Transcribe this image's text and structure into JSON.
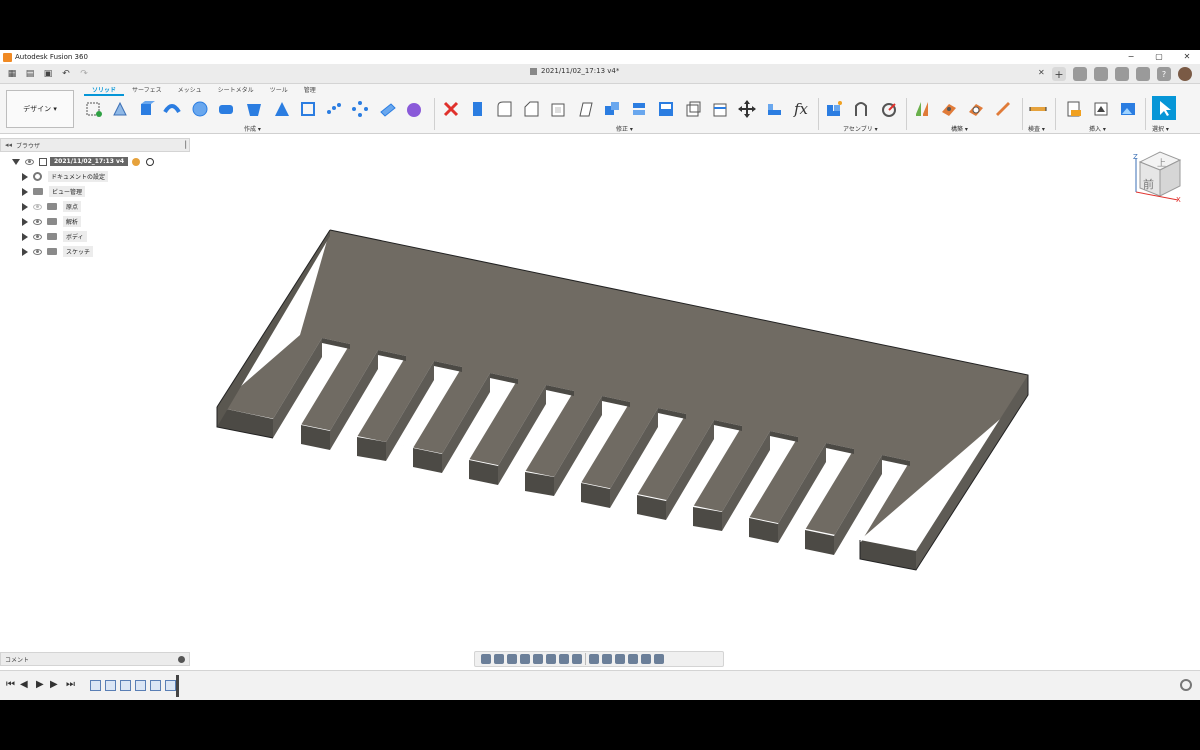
{
  "window": {
    "app_title": "Autodesk Fusion 360",
    "min": "−",
    "max": "▢",
    "close": "✕"
  },
  "document": {
    "tab_title": "2021/11/02_17:13 v4*",
    "tab_close": "✕"
  },
  "workspace": {
    "label": "デザイン ▾"
  },
  "ribbon": {
    "tabs": [
      "ソリッド",
      "サーフェス",
      "メッシュ",
      "シートメタル",
      "ツール",
      "管理"
    ],
    "groups": {
      "create": "作成 ▾",
      "modify": "修正 ▾",
      "assemble": "アセンブリ ▾",
      "construct": "構築 ▾",
      "inspect": "検査 ▾",
      "insert": "挿入 ▾",
      "select": "選択 ▾"
    },
    "fx_label": "fx"
  },
  "browser": {
    "title": "ブラウザ",
    "root": "2021/11/02_17:13 v4",
    "items": [
      {
        "label": "ドキュメントの設定"
      },
      {
        "label": "ビュー管理"
      },
      {
        "label": "原点"
      },
      {
        "label": "解析"
      },
      {
        "label": "ボディ"
      },
      {
        "label": "スケッチ"
      }
    ]
  },
  "comments": {
    "title": "コメント"
  },
  "viewcube": {
    "face_front": "前",
    "face_top": "上",
    "axis_z": "Z",
    "axis_x": "X"
  },
  "colors": {
    "accent": "#0696d7",
    "model_top": "#6f6a62",
    "model_side": "#5a5750",
    "model_front": "#4a4843"
  }
}
